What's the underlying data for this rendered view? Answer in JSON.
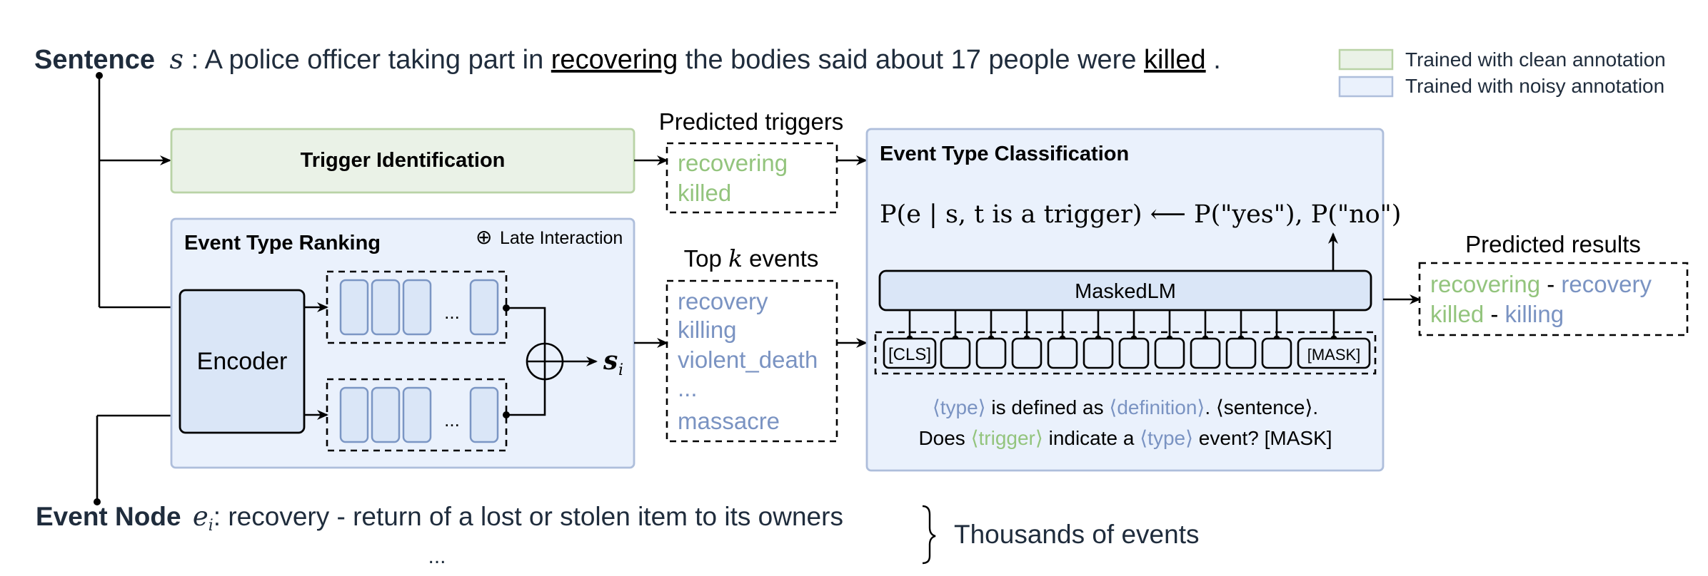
{
  "colors": {
    "clean_fill": "#eaf2e7",
    "clean_border": "#b9d3a6",
    "noisy_fill": "#eaf1fc",
    "noisy_border": "#aebedb",
    "trigger_text": "#93c47d",
    "event_text": "#7a93c2",
    "dark_text": "#1f2c3c"
  },
  "sentence": {
    "label": "Sentence",
    "symbol": "s",
    "colon": " : ",
    "prefix": "A police officer taking part in ",
    "trigger1": "recovering",
    "middle": " the bodies said about 17 people were ",
    "trigger2": "killed",
    "suffix": "."
  },
  "legend": {
    "items": [
      {
        "label": "Trained with clean annotation"
      },
      {
        "label": "Trained with noisy annotation"
      }
    ]
  },
  "trigger_identification": {
    "title": "Trigger Identification"
  },
  "predicted_triggers": {
    "title": "Predicted triggers",
    "items": [
      "recovering",
      "killed"
    ]
  },
  "event_type_ranking": {
    "title": "Event Type Ranking",
    "late_interaction_symbol": "⊕",
    "late_interaction_label": "Late Interaction",
    "encoder_label": "Encoder",
    "ellipsis": "...",
    "score_symbol": "s",
    "score_subscript": "i"
  },
  "top_k": {
    "title_prefix": "Top ",
    "title_k": "k",
    "title_suffix": " events",
    "items": [
      "recovery",
      "killing",
      "violent_death",
      "...",
      "massacre"
    ]
  },
  "event_type_classification": {
    "title": "Event Type Classification",
    "formula_left": "P(e | s, t is a trigger)",
    "formula_arrow": "⟵",
    "formula_right": "P(\"yes\"), P(\"no\")",
    "maskedlm_label": "MaskedLM",
    "cls_token": "[CLS]",
    "mask_token": "[MASK]",
    "template_line1": [
      {
        "text": "⟨type⟩",
        "color": "blue"
      },
      {
        "text": " is defined as ",
        "color": "black"
      },
      {
        "text": "⟨definition⟩",
        "color": "blue"
      },
      {
        "text": ". ⟨sentence⟩.",
        "color": "black"
      }
    ],
    "template_line2": [
      {
        "text": "Does ",
        "color": "black"
      },
      {
        "text": "⟨trigger⟩",
        "color": "green"
      },
      {
        "text": " indicate a ",
        "color": "black"
      },
      {
        "text": "⟨type⟩",
        "color": "blue"
      },
      {
        "text": " event? [MASK]",
        "color": "black"
      }
    ]
  },
  "predicted_results": {
    "title": "Predicted results",
    "pairs": [
      {
        "trigger": "recovering",
        "sep": " - ",
        "event": "recovery"
      },
      {
        "trigger": "killed",
        "sep": " - ",
        "event": "killing"
      }
    ]
  },
  "event_node": {
    "label": "Event Node",
    "symbol": "e",
    "subscript": "i",
    "colon": ": ",
    "text": "recovery - return of a lost or stolen item to its owners",
    "ellipsis": "...",
    "brace_label": "Thousands of events"
  }
}
